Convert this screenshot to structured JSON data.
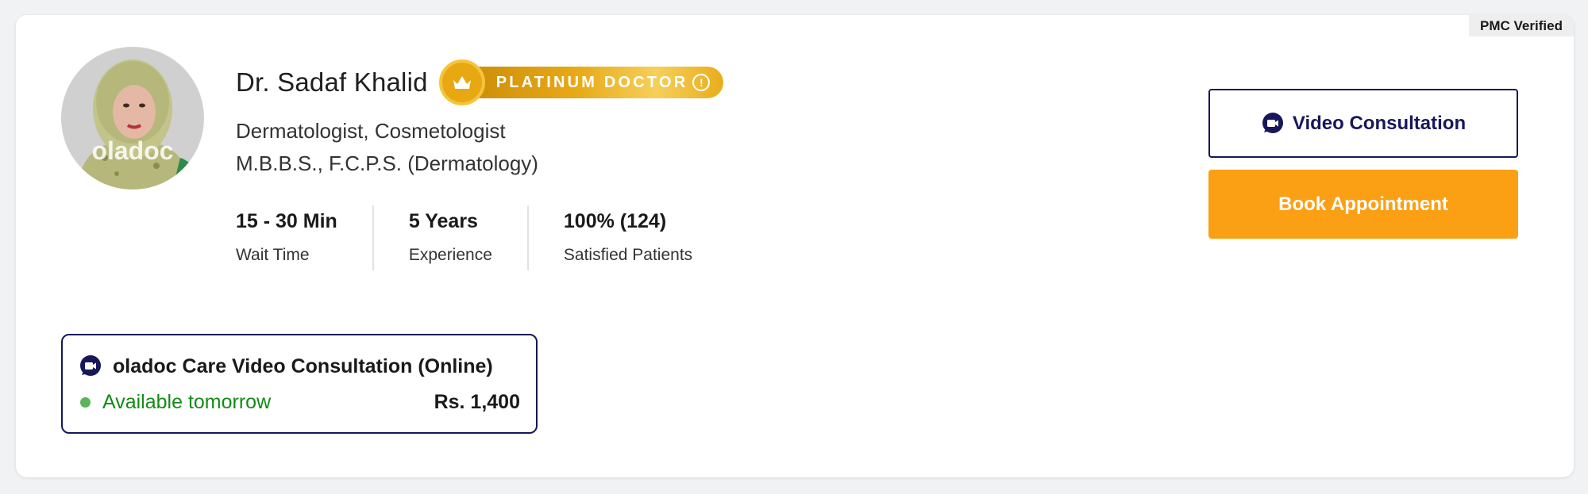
{
  "badge": {
    "pmc": "PMC Verified"
  },
  "doctor": {
    "name": "Dr. Sadaf Khalid",
    "tier_label": "PLATINUM DOCTOR",
    "specialty": "Dermatologist, Cosmetologist",
    "degrees": "M.B.B.S., F.C.P.S. (Dermatology)",
    "avatar_watermark": "oladoc"
  },
  "stats": [
    {
      "value": "15 - 30 Min",
      "label": "Wait Time"
    },
    {
      "value": "5 Years",
      "label": "Experience"
    },
    {
      "value": "100% (124)",
      "label": "Satisfied Patients"
    }
  ],
  "actions": {
    "video_label": "Video Consultation",
    "book_label": "Book Appointment"
  },
  "consultation": {
    "title": "oladoc Care Video Consultation (Online)",
    "availability": "Available tomorrow",
    "price": "Rs. 1,400"
  },
  "colors": {
    "navy": "#17175a",
    "orange": "#fb9f15",
    "gold": "#e8a812",
    "green": "#168a16"
  },
  "icons": [
    "crown-icon",
    "info-icon",
    "video-chat-icon",
    "availability-dot"
  ]
}
